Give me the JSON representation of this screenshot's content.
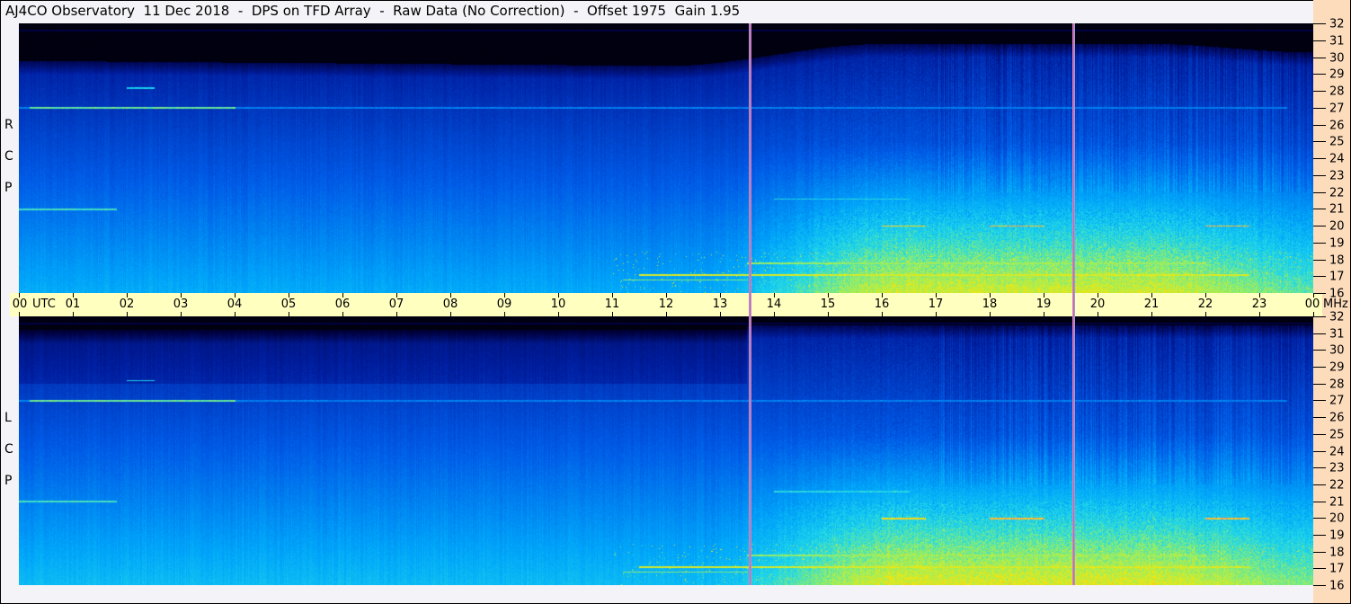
{
  "title": "AJ4CO Observatory  11 Dec 2018  -  DPS on TFD Array  -  Raw Data (No Correction)  -  Offset 1975  Gain 1.95",
  "panels": [
    {
      "name": "rcp",
      "letters": [
        "R",
        "C",
        "P"
      ]
    },
    {
      "name": "lcp",
      "letters": [
        "L",
        "C",
        "P"
      ]
    }
  ],
  "time_axis": {
    "labels": [
      "00",
      "01",
      "02",
      "03",
      "04",
      "05",
      "06",
      "07",
      "08",
      "09",
      "10",
      "11",
      "12",
      "13",
      "14",
      "15",
      "16",
      "17",
      "18",
      "19",
      "20",
      "21",
      "22",
      "23",
      "00"
    ],
    "unit": "UTC",
    "freq_unit": "MHz"
  },
  "freq_ticks": [
    "32",
    "31",
    "30",
    "29",
    "28",
    "27",
    "26",
    "25",
    "24",
    "23",
    "22",
    "21",
    "20",
    "19",
    "18",
    "17",
    "16"
  ],
  "chart_data": {
    "type": "heatmap",
    "title": "AJ4CO Observatory 11 Dec 2018 - DPS on TFD Array - Raw Data (No Correction) - Offset 1975 Gain 1.95",
    "xlabel": "UTC",
    "ylabel": "MHz",
    "xlim": [
      0,
      24
    ],
    "ylim": [
      16,
      32
    ],
    "series": [
      "RCP",
      "LCP"
    ],
    "markers_utc": [
      13.55,
      19.55
    ],
    "colors": {
      "low": "#000000",
      "mid": "#0064ff",
      "high": "#ffe600",
      "peak": "#ff3cc8"
    },
    "features": [
      {
        "freq": 27.0,
        "start": 0.2,
        "end": 4.0,
        "level": 0.78
      },
      {
        "freq": 27.0,
        "start": 0,
        "end": 23.5,
        "level": 0.55
      },
      {
        "freq": 28.2,
        "start": 2.0,
        "end": 2.5,
        "level": 0.7
      },
      {
        "freq": 21.0,
        "start": 0,
        "end": 1.8,
        "level": 0.75
      },
      {
        "freq": 17.1,
        "start": 11.5,
        "end": 22.8,
        "level": 0.88
      },
      {
        "freq": 16.8,
        "start": 11.2,
        "end": 13.5,
        "level": 0.8
      },
      {
        "freq": 17.8,
        "start": 13.5,
        "end": 22.0,
        "level": 0.82
      },
      {
        "freq": 20.0,
        "start": 16.0,
        "end": 16.8,
        "level": 0.92
      },
      {
        "freq": 20.0,
        "start": 18.0,
        "end": 19.0,
        "level": 0.95
      },
      {
        "freq": 20.0,
        "start": 22.0,
        "end": 22.8,
        "level": 0.95
      },
      {
        "freq": 21.6,
        "start": 14.0,
        "end": 16.5,
        "level": 0.72
      },
      {
        "freq": 16.3,
        "start": 16.0,
        "end": 23.0,
        "level": 0.78
      }
    ]
  }
}
